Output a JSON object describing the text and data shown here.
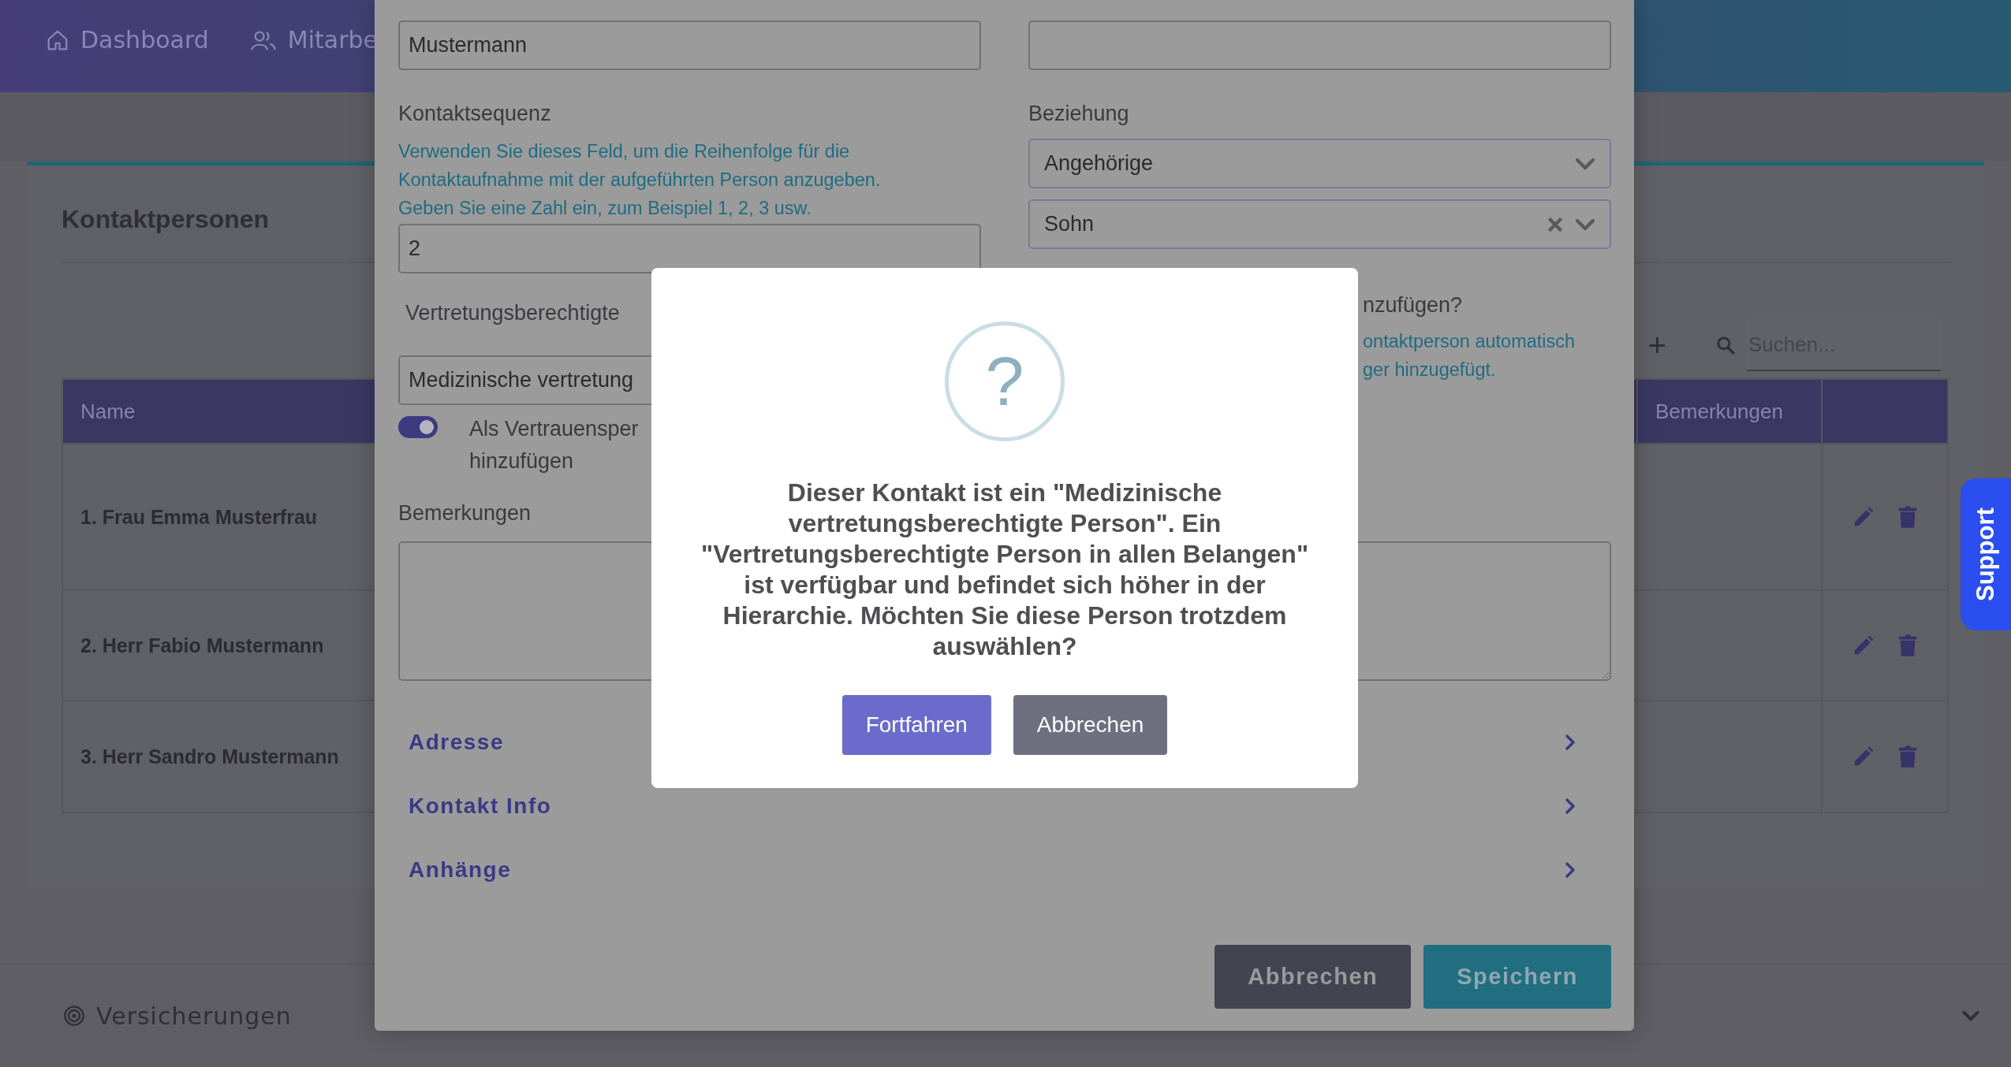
{
  "nav": [
    {
      "label": "Dashboard"
    },
    {
      "label": "Mitarbe"
    }
  ],
  "contacts": {
    "title": "Kontaktpersonen",
    "add": "+",
    "search": {
      "placeholder": "Suchen..."
    },
    "columns": [
      "Name",
      "Bemerkungen"
    ],
    "rows": [
      {
        "name": "1. Frau Emma Musterfrau"
      },
      {
        "name": "2. Herr Fabio Mustermann"
      },
      {
        "name": "3. Herr Sandro Mustermann"
      }
    ]
  },
  "insurance": {
    "title": "Versicherungen",
    "expanded": false
  },
  "support": "Support",
  "form": {
    "surname": {
      "value": "Mustermann"
    },
    "sequence": {
      "label": "Kontaktsequenz",
      "help": "Verwenden Sie dieses Feld, um die Reihenfolge für die\nKontaktaufnahme mit der aufgeführten Person anzugeben.\nGeben Sie eine Zahl ein, zum Beispiel 1, 2, 3 usw.",
      "value": "2"
    },
    "representative": {
      "label": "Vertretungsberechtigte",
      "value": "Medizinische vertretung"
    },
    "trust_toggle": {
      "label": "Als Vertrauensper\nhinzufügen",
      "on": true
    },
    "relation": {
      "label": "Beziehung",
      "type": "Angehörige",
      "person": "Sohn",
      "clearable": true
    },
    "trust_heading": "nzufügen?",
    "trust_help": "ontaktperson automatisch\nger hinzugefügt.",
    "remarks": {
      "label": "Bemerkungen"
    },
    "sections": [
      {
        "label": "Adresse",
        "expanded": false
      },
      {
        "label": "Kontakt Info",
        "expanded": false
      },
      {
        "label": "Anhänge",
        "expanded": false
      }
    ],
    "buttons": [
      {
        "label": "Abbrechen",
        "kind": "secondary"
      },
      {
        "label": "Speichern",
        "kind": "primary"
      }
    ]
  },
  "dialog": {
    "icon": "?",
    "message": "Dieser Kontakt ist ein \"Medizinische vertretungsberechtigte Person\". Ein \"Vertretungsberechtigte Person in allen Belangen\" ist verfügbar und befindet sich höher in der Hierarchie. Möchten Sie diese Person trotzdem auswählen?",
    "buttons": [
      {
        "label": "Fortfahren",
        "kind": "confirm"
      },
      {
        "label": "Abbrechen",
        "kind": "cancel"
      }
    ]
  }
}
